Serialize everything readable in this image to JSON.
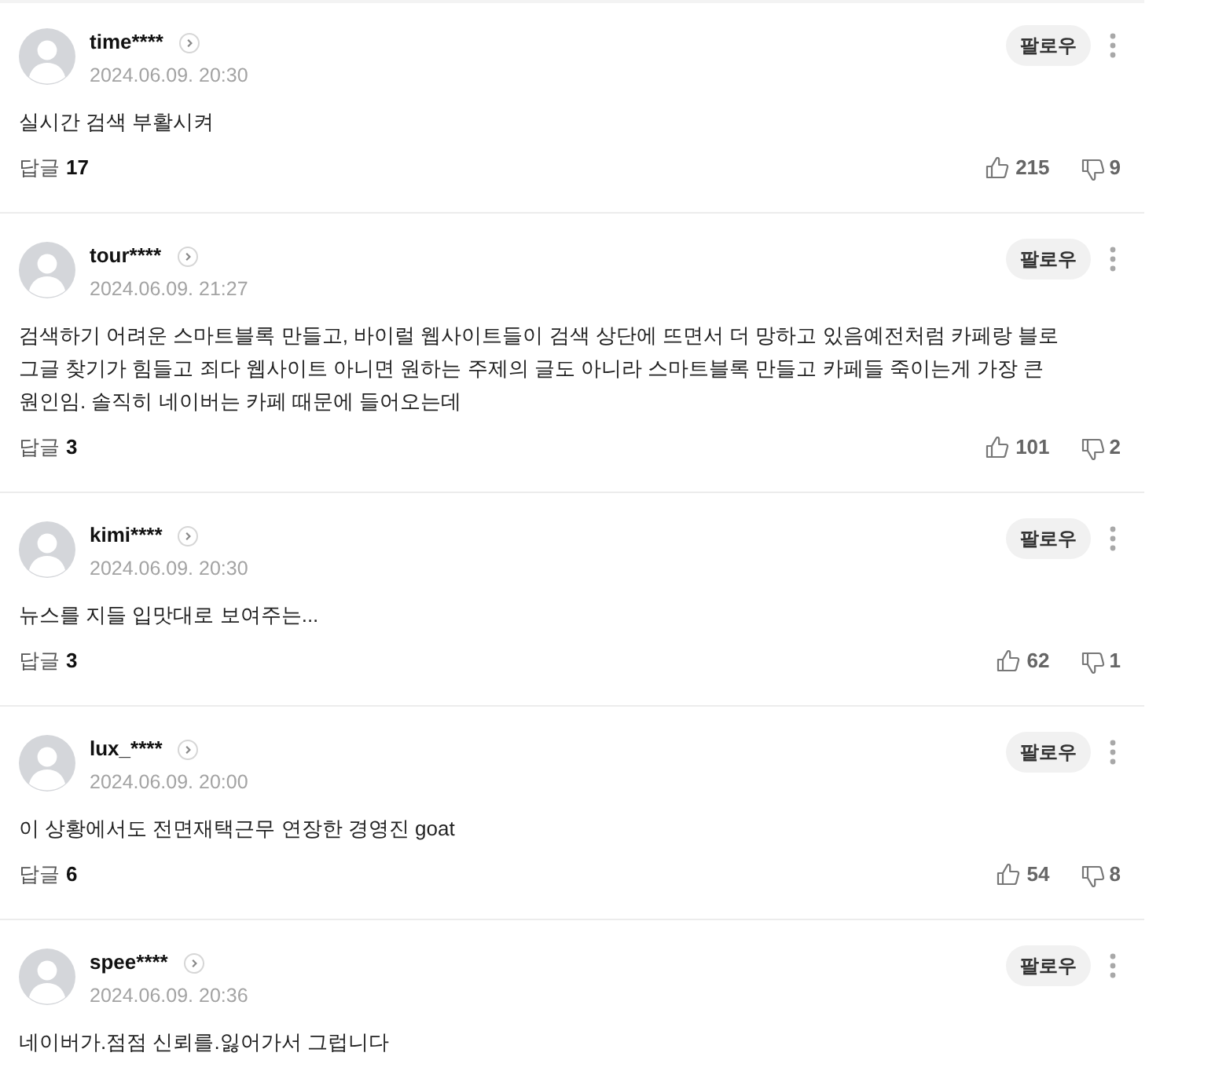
{
  "comments": [
    {
      "user": "time****",
      "date": "2024.06.09. 20:30",
      "follow_label": "팔로우",
      "text": "실시간 검색 부활시켜",
      "reply_label": "답글",
      "reply_count": "17",
      "likes": "215",
      "dislikes": "9"
    },
    {
      "user": "tour****",
      "date": "2024.06.09. 21:27",
      "follow_label": "팔로우",
      "text": "검색하기 어려운 스마트블록 만들고, 바이럴 웹사이트들이 검색 상단에 뜨면서 더 망하고 있음예전처럼 카페랑 블로그글 찾기가 힘들고 죄다 웹사이트 아니면 원하는 주제의 글도 아니라 스마트블록 만들고 카페들 죽이는게 가장 큰 원인임. 솔직히 네이버는 카페 때문에 들어오는데",
      "reply_label": "답글",
      "reply_count": "3",
      "likes": "101",
      "dislikes": "2"
    },
    {
      "user": "kimi****",
      "date": "2024.06.09. 20:30",
      "follow_label": "팔로우",
      "text": "뉴스를 지들 입맛대로 보여주는...",
      "reply_label": "답글",
      "reply_count": "3",
      "likes": "62",
      "dislikes": "1"
    },
    {
      "user": "lux_****",
      "date": "2024.06.09. 20:00",
      "follow_label": "팔로우",
      "text": "이 상황에서도 전면재택근무 연장한 경영진 goat",
      "reply_label": "답글",
      "reply_count": "6",
      "likes": "54",
      "dislikes": "8"
    },
    {
      "user": "spee****",
      "date": "2024.06.09. 20:36",
      "follow_label": "팔로우",
      "text": "네이버가.점점 신뢰를.잃어가서 그럽니다"
    }
  ]
}
